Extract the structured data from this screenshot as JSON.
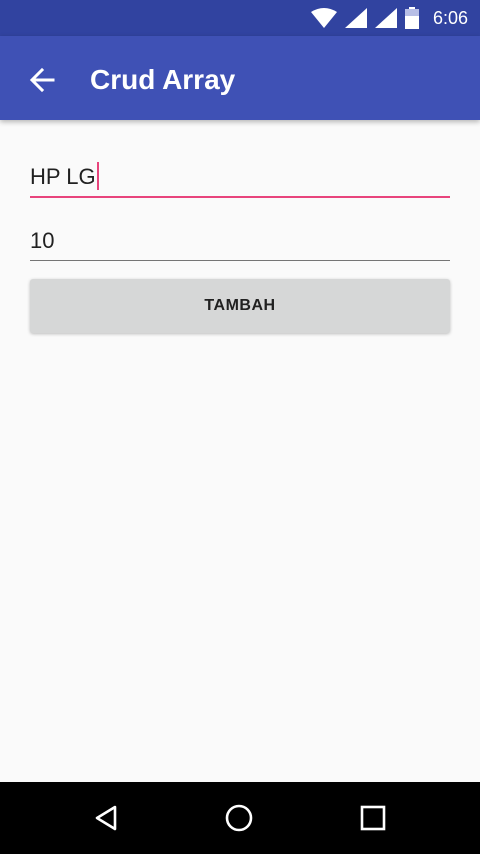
{
  "status_bar": {
    "time": "6:06",
    "icons": [
      "wifi-icon",
      "signal-icon",
      "signal-icon",
      "battery-icon"
    ]
  },
  "app_bar": {
    "title": "Crud Array",
    "back_icon": "arrow-left-icon"
  },
  "form": {
    "name_value": "HP LG",
    "quantity_value": "10",
    "add_button_label": "TAMBAH"
  },
  "nav_bar": {
    "icons": [
      "back-triangle-icon",
      "home-circle-icon",
      "recents-square-icon"
    ]
  },
  "colors": {
    "primary": "#3f51b5",
    "primary_dark": "#3143a0",
    "accent": "#e8447c",
    "background": "#fafafa",
    "button": "#d6d7d7"
  }
}
